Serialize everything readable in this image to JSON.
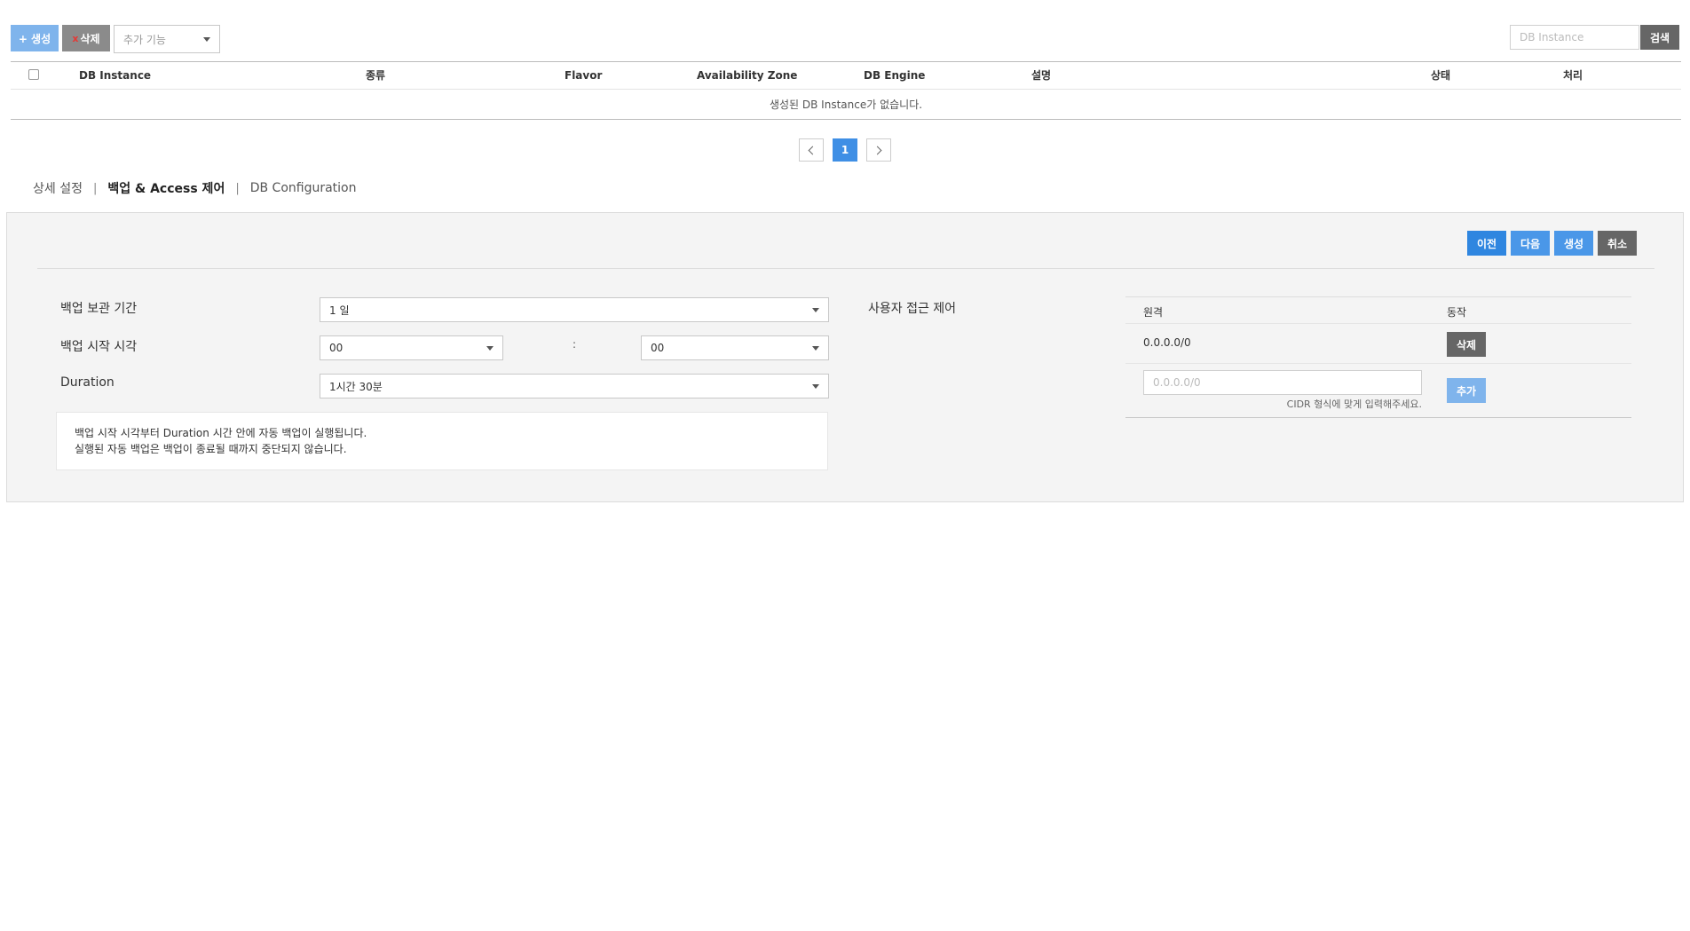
{
  "toolbar": {
    "create_label": "+ 생성",
    "delete_x": "x",
    "delete_label": "삭제",
    "extra_placeholder": "추가 기능",
    "search_placeholder": "DB Instance",
    "search_label": "검색"
  },
  "table": {
    "columns": [
      "DB Instance",
      "종류",
      "Flavor",
      "Availability Zone",
      "DB Engine",
      "설명",
      "상태",
      "처리"
    ],
    "empty_message": "생성된 DB Instance가 없습니다."
  },
  "pagination": {
    "current_page": "1"
  },
  "tabs": [
    {
      "label": "상세 설정"
    },
    {
      "label": "백업 & Access 제어"
    },
    {
      "label": "DB Configuration"
    }
  ],
  "tab_separator": "|",
  "actions": {
    "prev": "이전",
    "next": "다음",
    "create": "생성",
    "cancel": "취소"
  },
  "backup": {
    "retention_label": "백업 보관 기간",
    "retention_value": "1 일",
    "start_label": "백업 시작 시각",
    "start_hour": "00",
    "start_colon": ":",
    "start_minute": "00",
    "duration_label": "Duration",
    "duration_value": "1시간 30분",
    "note_line1": "백업 시작 시각부터 Duration 시간 안에 자동 백업이 실행됩니다.",
    "note_line2": "실행된 자동 백업은 백업이 종료될 때까지 중단되지 않습니다."
  },
  "access": {
    "label": "사용자 접근 제어",
    "col_remote": "원격",
    "col_action": "동작",
    "rows": [
      {
        "cidr": "0.0.0.0/0",
        "delete_label": "삭제"
      }
    ],
    "input_placeholder": "0.0.0.0/0",
    "add_label": "추가",
    "hint": "CIDR 형식에 맞게 입력해주세요."
  }
}
